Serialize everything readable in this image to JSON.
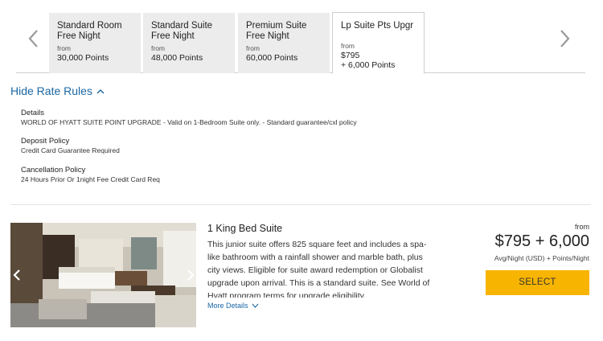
{
  "rate_tabs": [
    {
      "name": "Standard Room\nFree Night",
      "from": "from",
      "price": "30,000 Points"
    },
    {
      "name": "Standard Suite\nFree Night",
      "from": "from",
      "price": "48,000 Points"
    },
    {
      "name": "Premium Suite\nFree Night",
      "from": "from",
      "price": "60,000 Points"
    },
    {
      "name": "Lp Suite Pts Upgr",
      "from": "from",
      "price": "$795",
      "price2": "+ 6,000 Points"
    }
  ],
  "rules": {
    "toggle_label": "Hide Rate Rules",
    "details_title": "Details",
    "details_text": "WORLD OF HYATT SUITE POINT UPGRADE - Valid on 1-Bedroom Suite only. - Standard guarantee/cxl policy",
    "deposit_title": "Deposit Policy",
    "deposit_text": "Credit Card Guarantee Required",
    "cancel_title": "Cancellation Policy",
    "cancel_text": "24 Hours Prior Or 1night Fee Credit Card Req"
  },
  "room": {
    "title": "1 King Bed Suite",
    "description": "This junior suite offers 825 square feet and includes a spa-like bathroom with a rainfall shower and marble bath, plus city views. Eligible for suite award redemption or Globalist upgrade upon arrival. This is a standard suite. See World of Hyatt program terms for upgrade eligibility.",
    "more_details": "More Details",
    "price_from": "from",
    "price": "$795 + 6,000",
    "price_unit": "Avg/Night (USD) + Points/Night",
    "select_label": "SELECT"
  },
  "colors": {
    "accent": "#1a67a5",
    "select": "#f7b400"
  },
  "icons": {
    "prev": "chevron-left-icon",
    "next": "chevron-right-icon",
    "toggle": "chevron-up-icon",
    "more": "chevron-down-icon"
  }
}
